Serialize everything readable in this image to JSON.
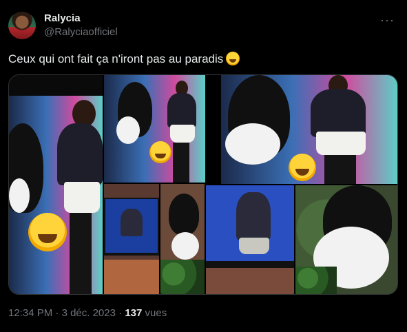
{
  "author": {
    "display_name": "Ralycia",
    "handle": "@Ralyciaofficiel",
    "avatar": "profile-photo"
  },
  "menu": {
    "more_label": "···"
  },
  "tweet": {
    "text": "Ceux qui ont fait ça n'iront pas au paradis",
    "emoji": "rolling-on-the-floor-laughing-emoji"
  },
  "media": {
    "description_icons": [
      "magpie-bird",
      "woman-in-studio",
      "laughing-emoji",
      "tv-screen"
    ]
  },
  "meta": {
    "time": "12:34 PM",
    "separator": " · ",
    "date": "3 déc. 2023",
    "views_count": "137",
    "views_label": "vues"
  }
}
